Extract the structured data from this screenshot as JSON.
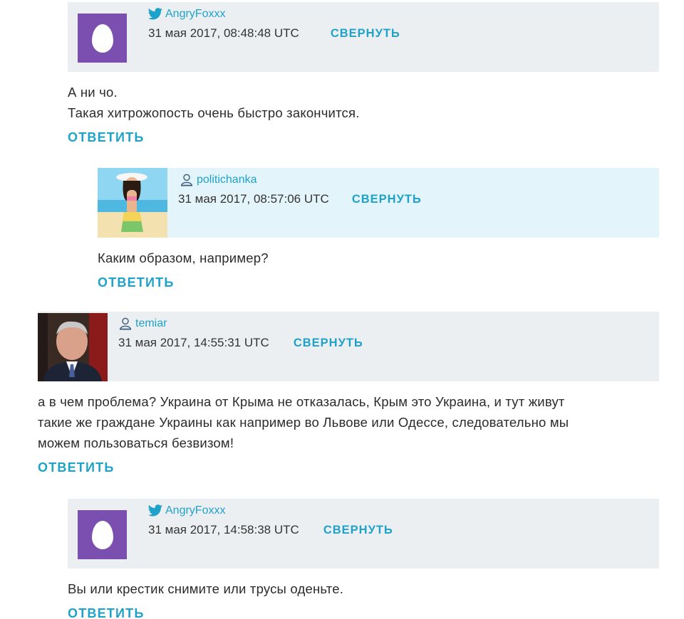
{
  "colors": {
    "accent": "#1fa2c9",
    "header_bg": "#eceff2",
    "header_bg_highlight": "#e3f4fa",
    "egg_avatar": "#7b4fb0"
  },
  "comments": [
    {
      "author": "AngryFoxxx",
      "source_icon": "twitter-bird-icon",
      "avatar": "egg-avatar",
      "timestamp": "31 мая 2017, 08:48:48 UTC",
      "collapse_label": "СВЕРНУТЬ",
      "text_lines": [
        "А ни чо.",
        "Такая хитрожопость очень быстро закончится."
      ],
      "reply_label": "ОТВЕТИТЬ"
    },
    {
      "author": "politichanka",
      "source_icon": "site-user-icon",
      "avatar": "beach-girl-avatar",
      "timestamp": "31 мая 2017, 08:57:06 UTC",
      "collapse_label": "СВЕРНУТЬ",
      "text_lines": [
        "Каким образом, например?"
      ],
      "reply_label": "ОТВЕТИТЬ"
    },
    {
      "author": "temiar",
      "source_icon": "site-user-icon",
      "avatar": "man-photo-avatar",
      "timestamp": "31 мая 2017, 14:55:31 UTC",
      "collapse_label": "СВЕРНУТЬ",
      "text_lines": [
        "а в чем проблема? Украина от Крыма не отказалась, Крым это Украина, и тут живут",
        "такие же граждане Украины как например во Львове или Одессе, следовательно мы",
        "можем пользоваться безвизом!"
      ],
      "reply_label": "ОТВЕТИТЬ"
    },
    {
      "author": "AngryFoxxx",
      "source_icon": "twitter-bird-icon",
      "avatar": "egg-avatar",
      "timestamp": "31 мая 2017, 14:58:38 UTC",
      "collapse_label": "СВЕРНУТЬ",
      "text_lines": [
        "Вы или крестик снимите или трусы оденьте."
      ],
      "reply_label": "ОТВЕТИТЬ"
    }
  ]
}
